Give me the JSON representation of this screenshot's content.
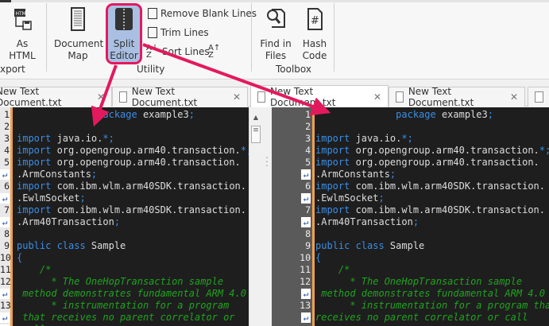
{
  "ribbon": {
    "export": {
      "btn_line1": "As",
      "btn_line2": "HTML",
      "group": "xport"
    },
    "utility": {
      "doc_map_line1": "Document",
      "doc_map_line2": "Map",
      "split_line1": "Split",
      "split_line2": "Editor",
      "remove_blank": "Remove Blank Lines",
      "trim": "Trim Lines",
      "sort": "Sort Lines",
      "group": "Utility"
    },
    "toolbox": {
      "find_line1": "Find in",
      "find_line2": "Files",
      "hash_line1": "Hash",
      "hash_line2": "Code",
      "group": "Toolbox"
    }
  },
  "tabs": [
    {
      "label": "New Text Document.txt"
    },
    {
      "label": "New Text Document.txt"
    },
    {
      "label": "New Text Document.txt"
    },
    {
      "label": "New Text Document.txt"
    }
  ],
  "colors": {
    "accent": "#e3195e",
    "keyword": "#3a8ee6",
    "comment": "#1fa31f",
    "gutter_marker": "#f0a050"
  },
  "left_rows": [
    {
      "g": "1",
      "s": [
        [
          "sp",
          "              "
        ],
        [
          "kw",
          "package"
        ],
        [
          "tx",
          " example3"
        ],
        [
          "pn",
          ";"
        ]
      ]
    },
    {
      "g": "2",
      "s": []
    },
    {
      "g": "3",
      "s": [
        [
          "kw",
          "import"
        ],
        [
          "tx",
          " java.io."
        ],
        [
          "pn",
          "*;"
        ]
      ]
    },
    {
      "g": "4",
      "s": [
        [
          "kw",
          "import"
        ],
        [
          "tx",
          " org.opengroup.arm40.transaction."
        ],
        [
          "pn",
          "*;"
        ]
      ]
    },
    {
      "g": "5",
      "s": [
        [
          "kw",
          "import"
        ],
        [
          "tx",
          " org.opengroup.arm40.transaction."
        ]
      ]
    },
    {
      "g": "↵",
      "s": [
        [
          "tx",
          ".ArmConstants"
        ],
        [
          "pn",
          ";"
        ]
      ]
    },
    {
      "g": "6",
      "s": [
        [
          "kw",
          "import"
        ],
        [
          "tx",
          " com.ibm.wlm.arm40SDK.transaction."
        ]
      ]
    },
    {
      "g": "↵",
      "s": [
        [
          "tx",
          ".EwlmSocket"
        ],
        [
          "pn",
          ";"
        ]
      ]
    },
    {
      "g": "7",
      "s": [
        [
          "kw",
          "import"
        ],
        [
          "tx",
          " com.ibm.wlm.arm40SDK.transaction."
        ]
      ]
    },
    {
      "g": "↵",
      "s": [
        [
          "tx",
          ".Arm40Transaction"
        ],
        [
          "pn",
          ";"
        ]
      ]
    },
    {
      "g": "8",
      "s": []
    },
    {
      "g": "9",
      "s": [
        [
          "kw",
          "public class"
        ],
        [
          "tx",
          " Sample"
        ]
      ]
    },
    {
      "g": "10",
      "s": [
        [
          "pn",
          "{"
        ]
      ]
    },
    {
      "g": "11",
      "s": [
        [
          "cm",
          "    /*"
        ]
      ]
    },
    {
      "g": "12",
      "s": [
        [
          "cm",
          "      * The OneHopTransaction sample"
        ]
      ]
    },
    {
      "g": "↵",
      "s": [
        [
          "cm",
          " method demonstrates fundamental ARM 4.0"
        ]
      ]
    },
    {
      "g": "13",
      "s": [
        [
          "cm",
          "      * instrumentation for a program"
        ]
      ]
    },
    {
      "g": "↵",
      "s": [
        [
          "cm",
          " that receives no parent correlator or"
        ]
      ]
    },
    {
      "g": "↵",
      "s": [
        [
          "cm",
          " call"
        ]
      ]
    }
  ],
  "right_rows": [
    {
      "g": "1",
      "s": [
        [
          "sp",
          "              "
        ],
        [
          "kw",
          "package"
        ],
        [
          "tx",
          " example3"
        ],
        [
          "pn",
          ";"
        ]
      ]
    },
    {
      "g": "2",
      "s": []
    },
    {
      "g": "3",
      "s": [
        [
          "kw",
          "import"
        ],
        [
          "tx",
          " java.io."
        ],
        [
          "pn",
          "*;"
        ]
      ]
    },
    {
      "g": "4",
      "s": [
        [
          "kw",
          "import"
        ],
        [
          "tx",
          " org.opengroup.arm40.transaction."
        ],
        [
          "pn",
          "*;"
        ]
      ]
    },
    {
      "g": "5",
      "s": [
        [
          "kw",
          "import"
        ],
        [
          "tx",
          " org.opengroup.arm40.transaction."
        ]
      ]
    },
    {
      "g": "↵",
      "s": [
        [
          "tx",
          ".ArmConstants"
        ],
        [
          "pn",
          ";"
        ]
      ]
    },
    {
      "g": "6",
      "s": [
        [
          "kw",
          "import"
        ],
        [
          "tx",
          " com.ibm.wlm.arm40SDK.transaction."
        ]
      ]
    },
    {
      "g": "↵",
      "s": [
        [
          "tx",
          ".EwlmSocket"
        ],
        [
          "pn",
          ";"
        ]
      ]
    },
    {
      "g": "7",
      "s": [
        [
          "kw",
          "import"
        ],
        [
          "tx",
          " com.ibm.wlm.arm40SDK.transaction."
        ]
      ]
    },
    {
      "g": "↵",
      "s": [
        [
          "tx",
          ".Arm40Transaction"
        ],
        [
          "pn",
          ";"
        ]
      ]
    },
    {
      "g": "8",
      "s": []
    },
    {
      "g": "9",
      "s": [
        [
          "kw",
          "public class"
        ],
        [
          "tx",
          " Sample"
        ]
      ]
    },
    {
      "g": "10",
      "s": [
        [
          "pn",
          "{"
        ]
      ]
    },
    {
      "g": "11",
      "s": [
        [
          "cm",
          "    /*"
        ]
      ]
    },
    {
      "g": "12",
      "s": [
        [
          "cm",
          "      * The OneHopTransaction sample"
        ]
      ]
    },
    {
      "g": "↵",
      "s": [
        [
          "cm",
          " method demonstrates fundamental ARM 4.0"
        ]
      ]
    },
    {
      "g": "13",
      "s": [
        [
          "cm",
          "      * instrumentation for a program that"
        ]
      ]
    },
    {
      "g": "↵",
      "s": [
        [
          "cm",
          "receives no parent correlator or call"
        ]
      ]
    }
  ]
}
